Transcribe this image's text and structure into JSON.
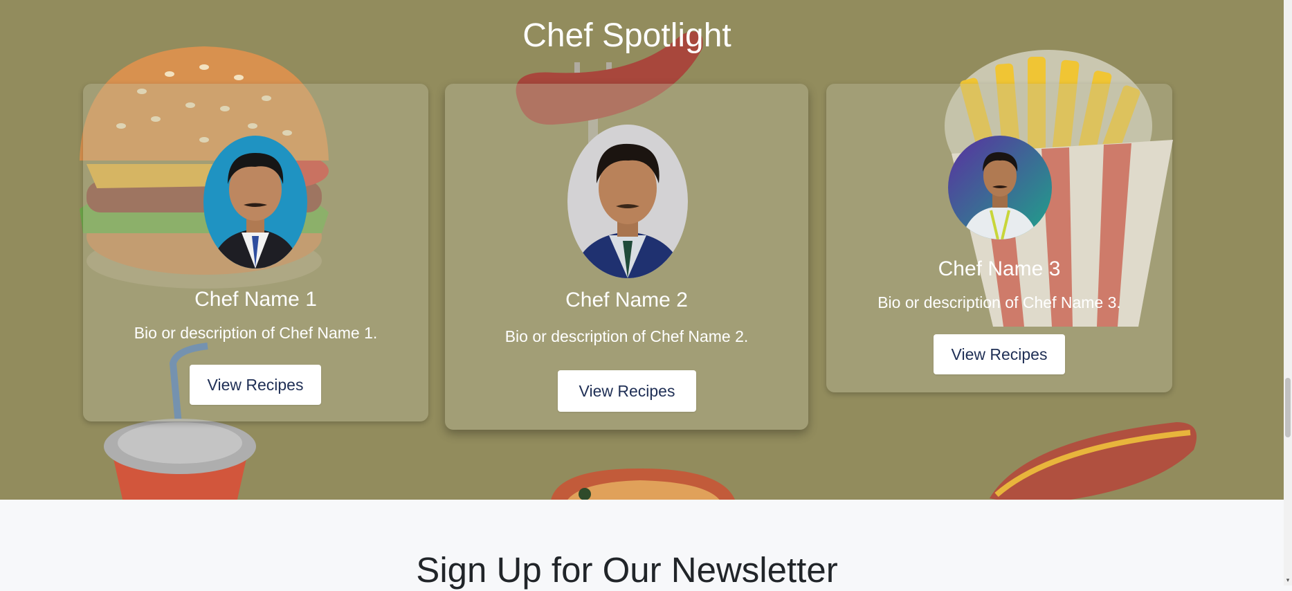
{
  "spotlight": {
    "title": "Chef Spotlight",
    "chefs": [
      {
        "name": "Chef Name 1",
        "bio": "Bio or description of Chef Name 1.",
        "button": "View Recipes"
      },
      {
        "name": "Chef Name 2",
        "bio": "Bio or description of Chef Name 2.",
        "button": "View Recipes"
      },
      {
        "name": "Chef Name 3",
        "bio": "Bio or description of Chef Name 3.",
        "button": "View Recipes"
      }
    ]
  },
  "newsletter": {
    "title": "Sign Up for Our Newsletter"
  },
  "colors": {
    "section_background": "#928c5d",
    "button_text": "#1f2f55",
    "page_background": "#f7f8fa"
  },
  "icons": [
    "burger-illustration",
    "hotdog-on-fork-illustration",
    "fries-illustration",
    "drink-cup-illustration",
    "hotdog-illustration",
    "pizza-illustration",
    "scroll-down-arrow-icon"
  ]
}
